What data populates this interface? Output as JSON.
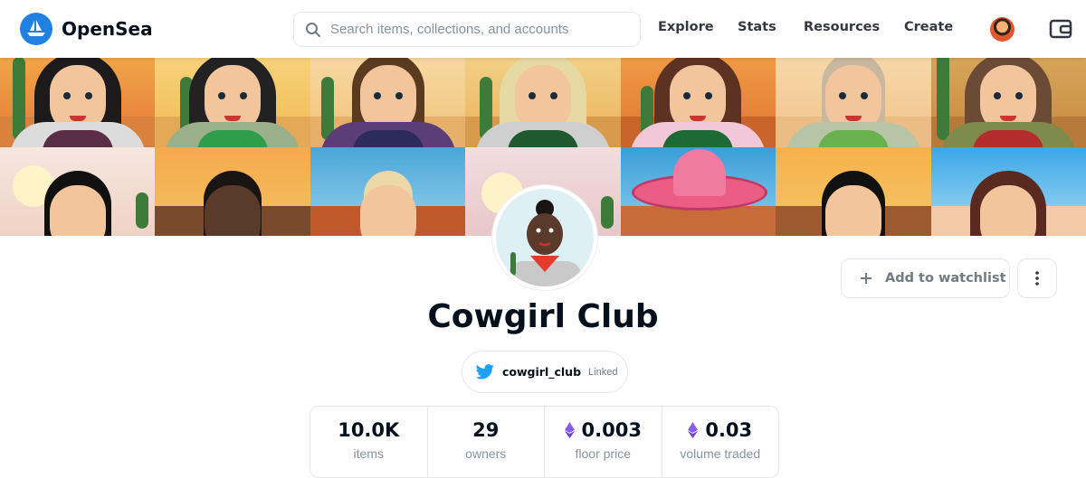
{
  "nav": {
    "logo_text": "OpenSea",
    "search_placeholder": "Search items, collections, and accounts",
    "links": [
      "Explore",
      "Stats",
      "Resources",
      "Create"
    ],
    "icons": {
      "search": "search-icon",
      "wallet": "wallet-icon",
      "profile": "user-avatar"
    }
  },
  "collection": {
    "name": "Cowgirl Club",
    "watchlist_label": "Add to watchlist",
    "twitter_handle": "cowgirl_club",
    "twitter_status": "Linked"
  },
  "stats": [
    {
      "value": "10.0K",
      "label": "items",
      "eth": false
    },
    {
      "value": "29",
      "label": "owners",
      "eth": false
    },
    {
      "value": "0.003",
      "label": "floor price",
      "eth": true
    },
    {
      "value": "0.03",
      "label": "volume traded",
      "eth": true
    }
  ],
  "colors": {
    "brand": "#2081e2",
    "twitter": "#1da1f2",
    "eth": "#8a5cf5",
    "text": "#04111d",
    "muted": "#8a939b"
  }
}
